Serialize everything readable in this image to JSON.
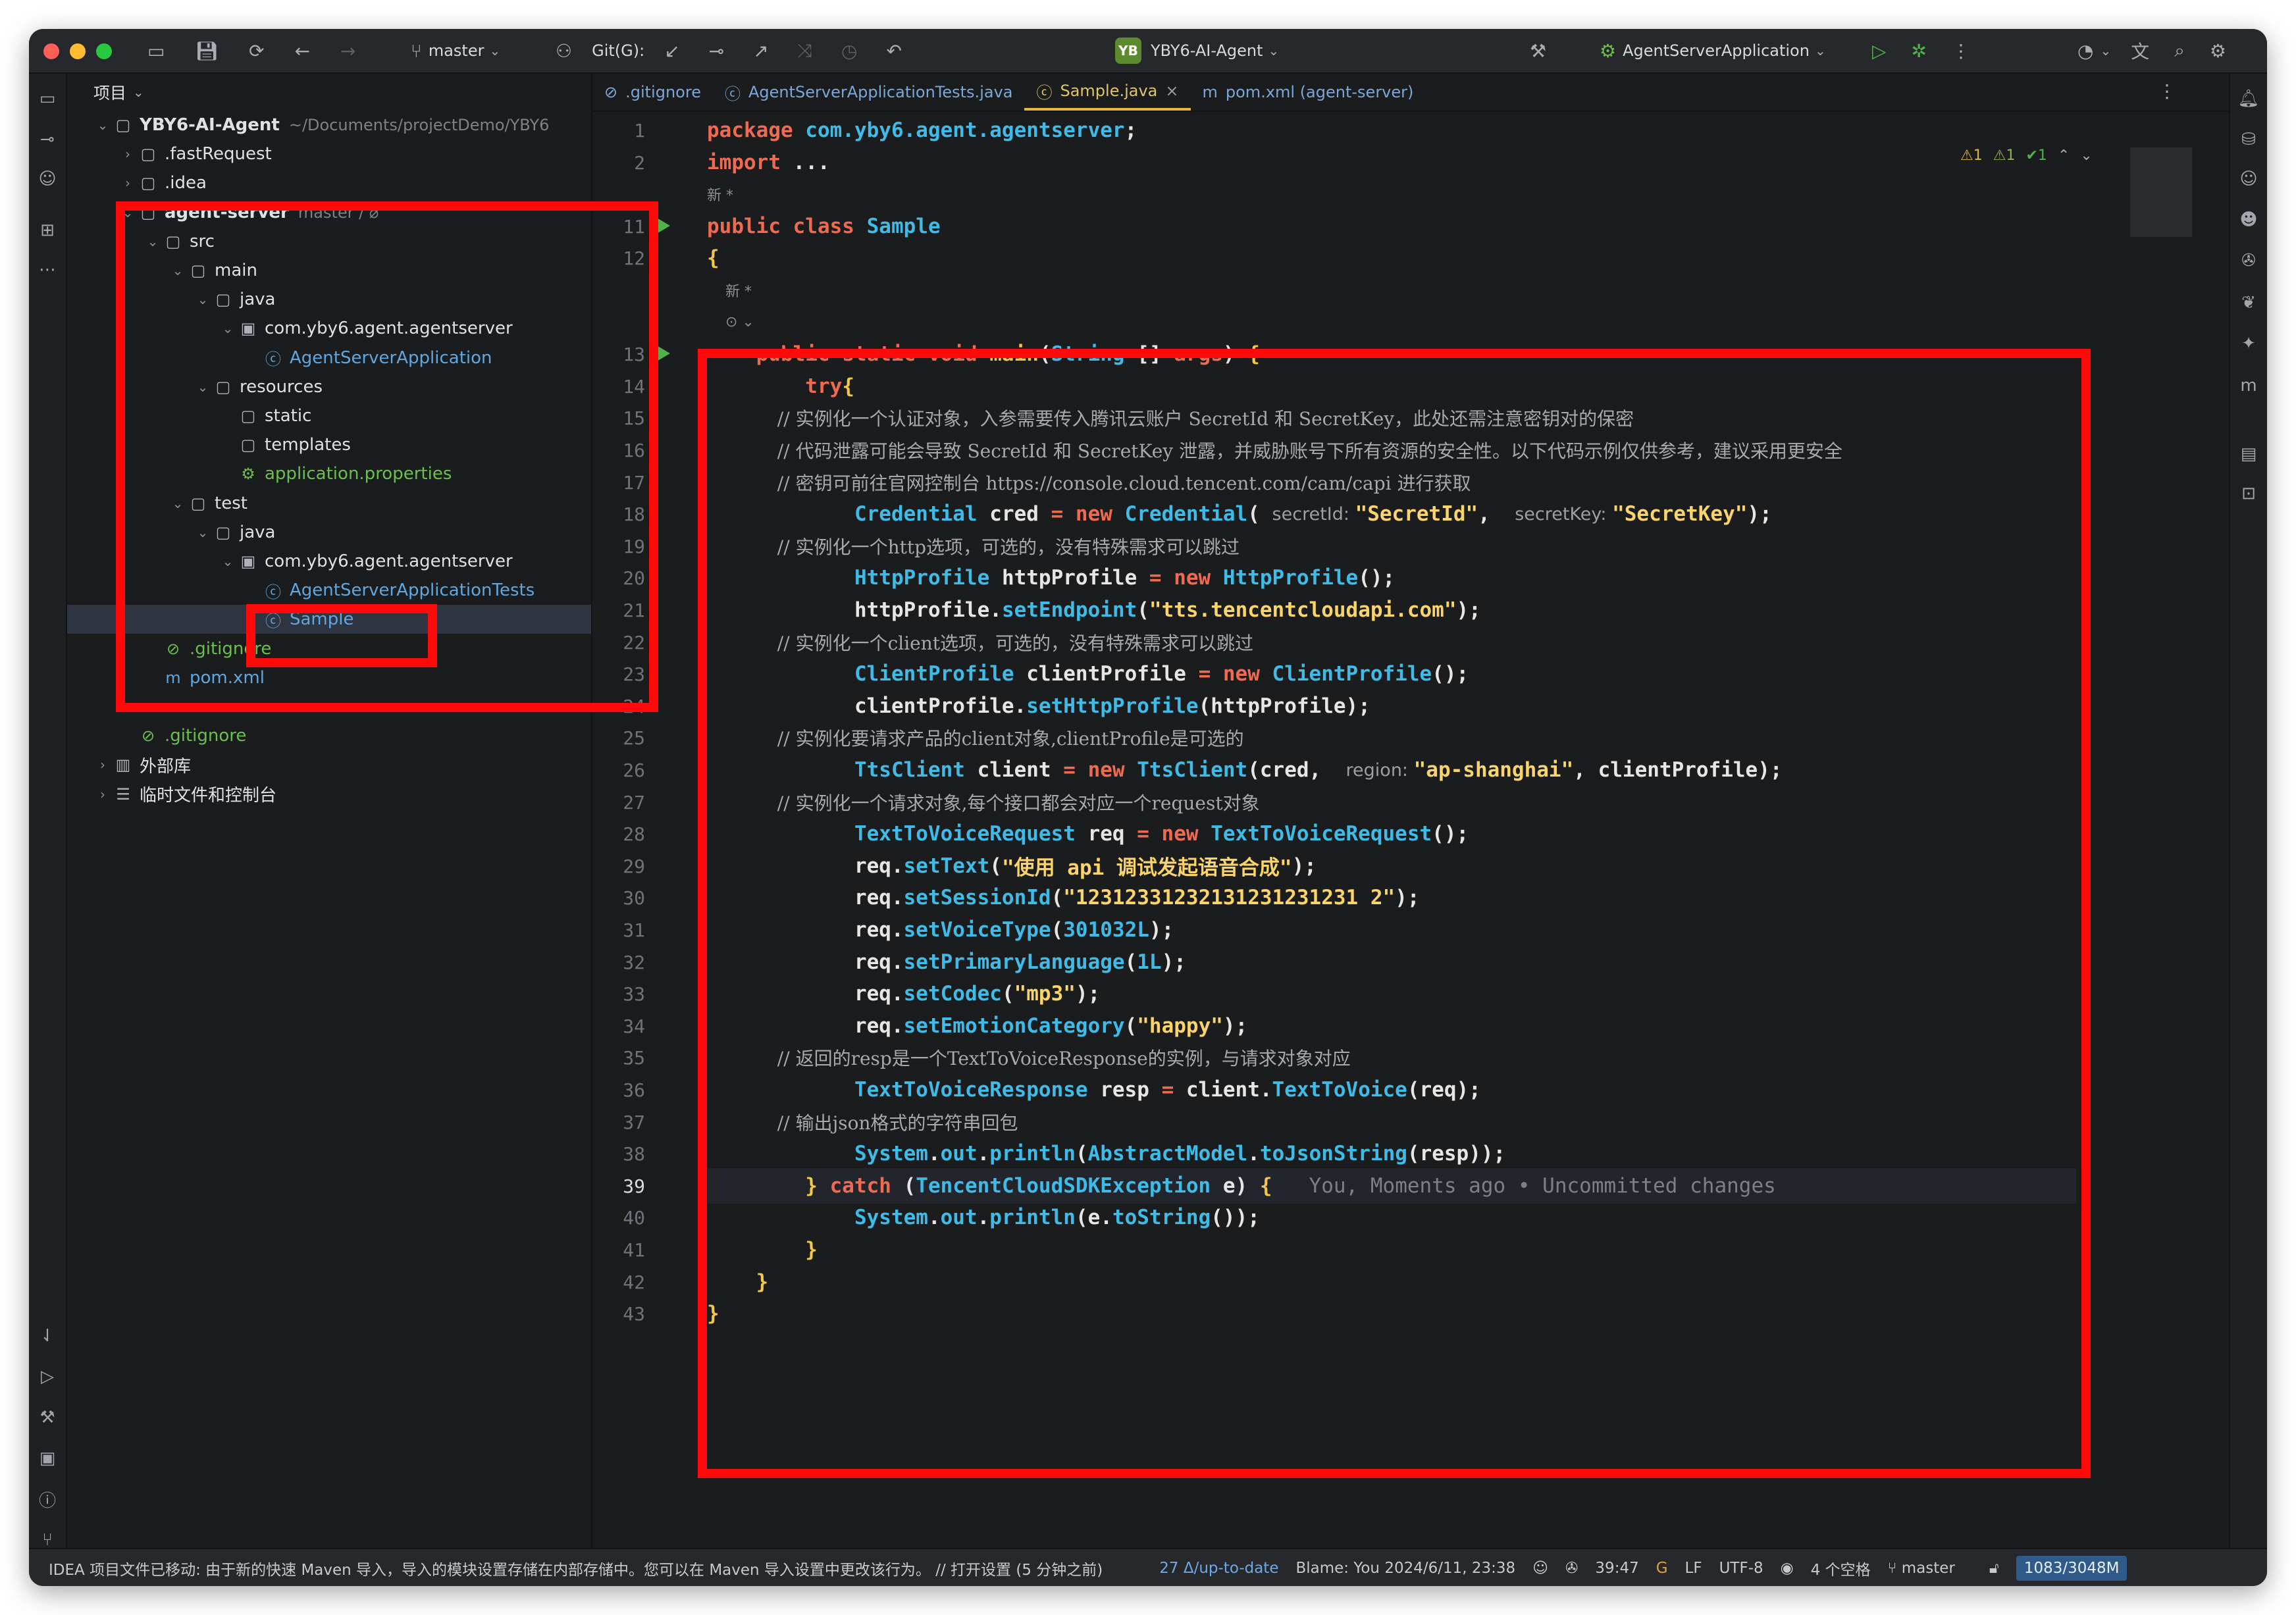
{
  "titlebar": {
    "branch": "master",
    "git_label": "Git(G):",
    "project_chip": "YB",
    "project_name": "YBY6-AI-Agent",
    "run_config": "AgentServerApplication"
  },
  "project_panel": {
    "header": "项目",
    "tree": [
      {
        "label": "YBY6-AI-Agent",
        "extra": "~/Documents/projectDemo/YBY6",
        "indent": 0,
        "arrow": "⌄",
        "icon": "▢"
      },
      {
        "label": ".fastRequest",
        "extra": "",
        "indent": 1,
        "arrow": "›",
        "icon": "▢"
      },
      {
        "label": ".idea",
        "extra": "",
        "indent": 1,
        "arrow": "›",
        "icon": "▢"
      },
      {
        "label": "agent-server",
        "extra": "master / ⌀",
        "indent": 1,
        "arrow": "⌄",
        "icon": "▢"
      },
      {
        "label": "src",
        "extra": "",
        "indent": 2,
        "arrow": "⌄",
        "icon": "▢"
      },
      {
        "label": "main",
        "extra": "",
        "indent": 3,
        "arrow": "⌄",
        "icon": "▢"
      },
      {
        "label": "java",
        "extra": "",
        "indent": 4,
        "arrow": "⌄",
        "icon": "▢"
      },
      {
        "label": "com.yby6.agent.agentserver",
        "extra": "",
        "indent": 5,
        "arrow": "⌄",
        "icon": "▣"
      },
      {
        "label": "AgentServerApplication",
        "extra": "",
        "indent": 6,
        "arrow": "",
        "icon": "ⓒ",
        "color": "#5fa7e0"
      },
      {
        "label": "resources",
        "extra": "",
        "indent": 4,
        "arrow": "⌄",
        "icon": "▢"
      },
      {
        "label": "static",
        "extra": "",
        "indent": 5,
        "arrow": "",
        "icon": "▢"
      },
      {
        "label": "templates",
        "extra": "",
        "indent": 5,
        "arrow": "",
        "icon": "▢"
      },
      {
        "label": "application.properties",
        "extra": "",
        "indent": 5,
        "arrow": "",
        "icon": "⚙",
        "color": "#6cbf4f"
      },
      {
        "label": "test",
        "extra": "",
        "indent": 3,
        "arrow": "⌄",
        "icon": "▢"
      },
      {
        "label": "java",
        "extra": "",
        "indent": 4,
        "arrow": "⌄",
        "icon": "▢"
      },
      {
        "label": "com.yby6.agent.agentserver",
        "extra": "",
        "indent": 5,
        "arrow": "⌄",
        "icon": "▣"
      },
      {
        "label": "AgentServerApplicationTests",
        "extra": "",
        "indent": 6,
        "arrow": "",
        "icon": "ⓒ",
        "color": "#5fa7e0"
      },
      {
        "label": "Sample",
        "extra": "",
        "indent": 6,
        "arrow": "",
        "icon": "ⓒ",
        "color": "#5fa7e0",
        "selected": true
      },
      {
        "label": ".gitignore",
        "extra": "",
        "indent": 2,
        "arrow": "",
        "icon": "⊘",
        "color": "#6cbf4f"
      },
      {
        "label": "pom.xml",
        "extra": "",
        "indent": 2,
        "arrow": "",
        "icon": "m",
        "color": "#5fa7e0"
      },
      {
        "label": "",
        "extra": "",
        "indent": 1,
        "arrow": "",
        "icon": ""
      },
      {
        "label": ".gitignore",
        "extra": "",
        "indent": 1,
        "arrow": "",
        "icon": "⊘",
        "color": "#6cbf4f"
      },
      {
        "label": "外部库",
        "extra": "",
        "indent": 0,
        "arrow": "›",
        "icon": "▥"
      },
      {
        "label": "临时文件和控制台",
        "extra": "",
        "indent": 0,
        "arrow": "›",
        "icon": "☰"
      }
    ]
  },
  "tabs": [
    {
      "label": ".gitignore",
      "icon": "⊘",
      "active": false
    },
    {
      "label": "AgentServerApplicationTests.java",
      "icon": "ⓒ",
      "active": false
    },
    {
      "label": "Sample.java",
      "icon": "ⓒ",
      "active": true
    },
    {
      "label": "pom.xml (agent-server)",
      "icon": "m",
      "active": false
    }
  ],
  "inspections": {
    "warn1": "⚠1",
    "warn2": "⚠1",
    "ok": "✔1"
  },
  "code": [
    {
      "n": "1",
      "segs": [
        [
          "k",
          "package "
        ],
        [
          "t",
          "com.yby6.agent.agentserver"
        ],
        [
          "v",
          ";"
        ]
      ]
    },
    {
      "n": "2",
      "segs": [
        [
          "k",
          "import "
        ],
        [
          "v",
          "..."
        ]
      ]
    },
    {
      "n": "",
      "segs": [
        [
          "small",
          "新 *"
        ]
      ]
    },
    {
      "n": "11",
      "run": true,
      "segs": [
        [
          "k",
          "public class "
        ],
        [
          "t",
          "Sample"
        ]
      ]
    },
    {
      "n": "12",
      "segs": [
        [
          "m",
          "{"
        ]
      ]
    },
    {
      "n": "",
      "segs": [
        [
          "small",
          "    新 *"
        ]
      ]
    },
    {
      "n": "",
      "segs": [
        [
          "small",
          "    ⊙ ⌄"
        ]
      ]
    },
    {
      "n": "13",
      "run": true,
      "segs": [
        [
          "k",
          "    public static void "
        ],
        [
          "m",
          "main"
        ],
        [
          "v",
          "("
        ],
        [
          "t",
          "String"
        ],
        [
          "v",
          " [] "
        ],
        [
          "k",
          "args"
        ],
        [
          "v",
          ") "
        ],
        [
          "m",
          "{"
        ]
      ]
    },
    {
      "n": "14",
      "segs": [
        [
          "k",
          "        try"
        ],
        [
          "m",
          "{"
        ]
      ]
    },
    {
      "n": "15",
      "segs": [
        [
          "c",
          "            // 实例化一个认证对象，入参需要传入腾讯云账户 SecretId 和 SecretKey，此处还需注意密钥对的保密"
        ]
      ]
    },
    {
      "n": "16",
      "segs": [
        [
          "c",
          "            // 代码泄露可能会导致 SecretId 和 SecretKey 泄露，并威胁账号下所有资源的安全性。以下代码示例仅供参考，建议采用更安全"
        ]
      ]
    },
    {
      "n": "17",
      "segs": [
        [
          "c",
          "            // 密钥可前往官网控制台 https://console.cloud.tencent.com/cam/capi 进行获取"
        ]
      ]
    },
    {
      "n": "18",
      "segs": [
        [
          "t",
          "            Credential "
        ],
        [
          "v",
          "cred "
        ],
        [
          "k",
          "= new "
        ],
        [
          "t",
          "Credential"
        ],
        [
          "v",
          "( "
        ],
        [
          "hint",
          "secretId: "
        ],
        [
          "s",
          "\"SecretId\""
        ],
        [
          "v",
          ",  "
        ],
        [
          "hint",
          "secretKey: "
        ],
        [
          "s",
          "\"SecretKey\""
        ],
        [
          "v",
          ");"
        ]
      ]
    },
    {
      "n": "19",
      "segs": [
        [
          "c",
          "            // 实例化一个http选项，可选的，没有特殊需求可以跳过"
        ]
      ]
    },
    {
      "n": "20",
      "segs": [
        [
          "t",
          "            HttpProfile "
        ],
        [
          "v",
          "httpProfile "
        ],
        [
          "k",
          "= new "
        ],
        [
          "t",
          "HttpProfile"
        ],
        [
          "v",
          "();"
        ]
      ]
    },
    {
      "n": "21",
      "segs": [
        [
          "v",
          "            httpProfile."
        ],
        [
          "t",
          "setEndpoint"
        ],
        [
          "v",
          "("
        ],
        [
          "s",
          "\"tts.tencentcloudapi.com\""
        ],
        [
          "v",
          ");"
        ]
      ]
    },
    {
      "n": "22",
      "segs": [
        [
          "c",
          "            // 实例化一个client选项，可选的，没有特殊需求可以跳过"
        ]
      ]
    },
    {
      "n": "23",
      "segs": [
        [
          "t",
          "            ClientProfile "
        ],
        [
          "v",
          "clientProfile "
        ],
        [
          "k",
          "= new "
        ],
        [
          "t",
          "ClientProfile"
        ],
        [
          "v",
          "();"
        ]
      ]
    },
    {
      "n": "24",
      "segs": [
        [
          "v",
          "            clientProfile."
        ],
        [
          "t",
          "setHttpProfile"
        ],
        [
          "v",
          "(httpProfile);"
        ]
      ]
    },
    {
      "n": "25",
      "segs": [
        [
          "c",
          "            // 实例化要请求产品的client对象,clientProfile是可选的"
        ]
      ]
    },
    {
      "n": "26",
      "segs": [
        [
          "t",
          "            TtsClient "
        ],
        [
          "v",
          "client "
        ],
        [
          "k",
          "= new "
        ],
        [
          "t",
          "TtsClient"
        ],
        [
          "v",
          "(cred,  "
        ],
        [
          "hint",
          "region: "
        ],
        [
          "s",
          "\"ap-shanghai\""
        ],
        [
          "v",
          ", clientProfile);"
        ]
      ]
    },
    {
      "n": "27",
      "segs": [
        [
          "c",
          "            // 实例化一个请求对象,每个接口都会对应一个request对象"
        ]
      ]
    },
    {
      "n": "28",
      "segs": [
        [
          "t",
          "            TextToVoiceRequest "
        ],
        [
          "v",
          "req "
        ],
        [
          "k",
          "= new "
        ],
        [
          "t",
          "TextToVoiceRequest"
        ],
        [
          "v",
          "();"
        ]
      ]
    },
    {
      "n": "29",
      "segs": [
        [
          "v",
          "            req."
        ],
        [
          "t",
          "setText"
        ],
        [
          "v",
          "("
        ],
        [
          "s",
          "\"使用 api 调试发起语音合成\""
        ],
        [
          "v",
          ");"
        ]
      ]
    },
    {
      "n": "30",
      "segs": [
        [
          "v",
          "            req."
        ],
        [
          "t",
          "setSessionId"
        ],
        [
          "v",
          "("
        ],
        [
          "s",
          "\"12312331232131231231231 2\""
        ],
        [
          "v",
          ");"
        ]
      ]
    },
    {
      "n": "31",
      "segs": [
        [
          "v",
          "            req."
        ],
        [
          "t",
          "setVoiceType"
        ],
        [
          "v",
          "("
        ],
        [
          "t",
          "301032L"
        ],
        [
          "v",
          ");"
        ]
      ]
    },
    {
      "n": "32",
      "segs": [
        [
          "v",
          "            req."
        ],
        [
          "t",
          "setPrimaryLanguage"
        ],
        [
          "v",
          "("
        ],
        [
          "t",
          "1L"
        ],
        [
          "v",
          ");"
        ]
      ]
    },
    {
      "n": "33",
      "segs": [
        [
          "v",
          "            req."
        ],
        [
          "t",
          "setCodec"
        ],
        [
          "v",
          "("
        ],
        [
          "s",
          "\"mp3\""
        ],
        [
          "v",
          ");"
        ]
      ]
    },
    {
      "n": "34",
      "segs": [
        [
          "v",
          "            req."
        ],
        [
          "t",
          "setEmotionCategory"
        ],
        [
          "v",
          "("
        ],
        [
          "s",
          "\"happy\""
        ],
        [
          "v",
          ");"
        ]
      ]
    },
    {
      "n": "35",
      "segs": [
        [
          "c",
          "            // 返回的resp是一个TextToVoiceResponse的实例，与请求对象对应"
        ]
      ]
    },
    {
      "n": "36",
      "segs": [
        [
          "t",
          "            TextToVoiceResponse "
        ],
        [
          "v",
          "resp "
        ],
        [
          "k",
          "= "
        ],
        [
          "v",
          "client."
        ],
        [
          "t",
          "TextToVoice"
        ],
        [
          "v",
          "(req);"
        ]
      ]
    },
    {
      "n": "37",
      "segs": [
        [
          "c",
          "            // 输出json格式的字符串回包"
        ]
      ]
    },
    {
      "n": "38",
      "segs": [
        [
          "t",
          "            System"
        ],
        [
          "v",
          "."
        ],
        [
          "t",
          "out"
        ],
        [
          "v",
          "."
        ],
        [
          "t",
          "println"
        ],
        [
          "v",
          "("
        ],
        [
          "t",
          "AbstractModel"
        ],
        [
          "v",
          "."
        ],
        [
          "t",
          "toJsonString"
        ],
        [
          "v",
          "(resp));"
        ]
      ]
    },
    {
      "n": "39",
      "current": true,
      "segs": [
        [
          "m",
          "        } "
        ],
        [
          "k",
          "catch "
        ],
        [
          "v",
          "("
        ],
        [
          "t",
          "TencentCloudSDKException "
        ],
        [
          "v",
          "e) "
        ],
        [
          "m",
          "{"
        ],
        [
          "blame",
          "   You, Moments ago • Uncommitted changes"
        ]
      ]
    },
    {
      "n": "40",
      "segs": [
        [
          "t",
          "            System"
        ],
        [
          "v",
          "."
        ],
        [
          "t",
          "out"
        ],
        [
          "v",
          "."
        ],
        [
          "t",
          "println"
        ],
        [
          "v",
          "(e."
        ],
        [
          "t",
          "toString"
        ],
        [
          "v",
          "());"
        ]
      ]
    },
    {
      "n": "41",
      "segs": [
        [
          "m",
          "        }"
        ]
      ]
    },
    {
      "n": "42",
      "segs": [
        [
          "m",
          "    }"
        ]
      ]
    },
    {
      "n": "43",
      "segs": [
        [
          "m",
          "}"
        ]
      ]
    }
  ],
  "status": {
    "message": "IDEA 项目文件已移动: 由于新的快速 Maven 导入，导入的模块设置存储在内部存储中。您可以在 Maven 导入设置中更改该行为。 // 打开设置 (5 分钟之前)",
    "vcs": "27 Δ/up-to-date",
    "blame": "Blame: You 2024/6/11, 23:38",
    "position": "39:47",
    "line_sep": "LF",
    "encoding": "UTF-8",
    "indent": "4 个空格",
    "branch": "master",
    "memory": "1083/3048M"
  },
  "colors": {
    "highlight_box": "#ff0a0a",
    "accent_tab": "#e8b640",
    "run_green": "#4fb04c"
  }
}
